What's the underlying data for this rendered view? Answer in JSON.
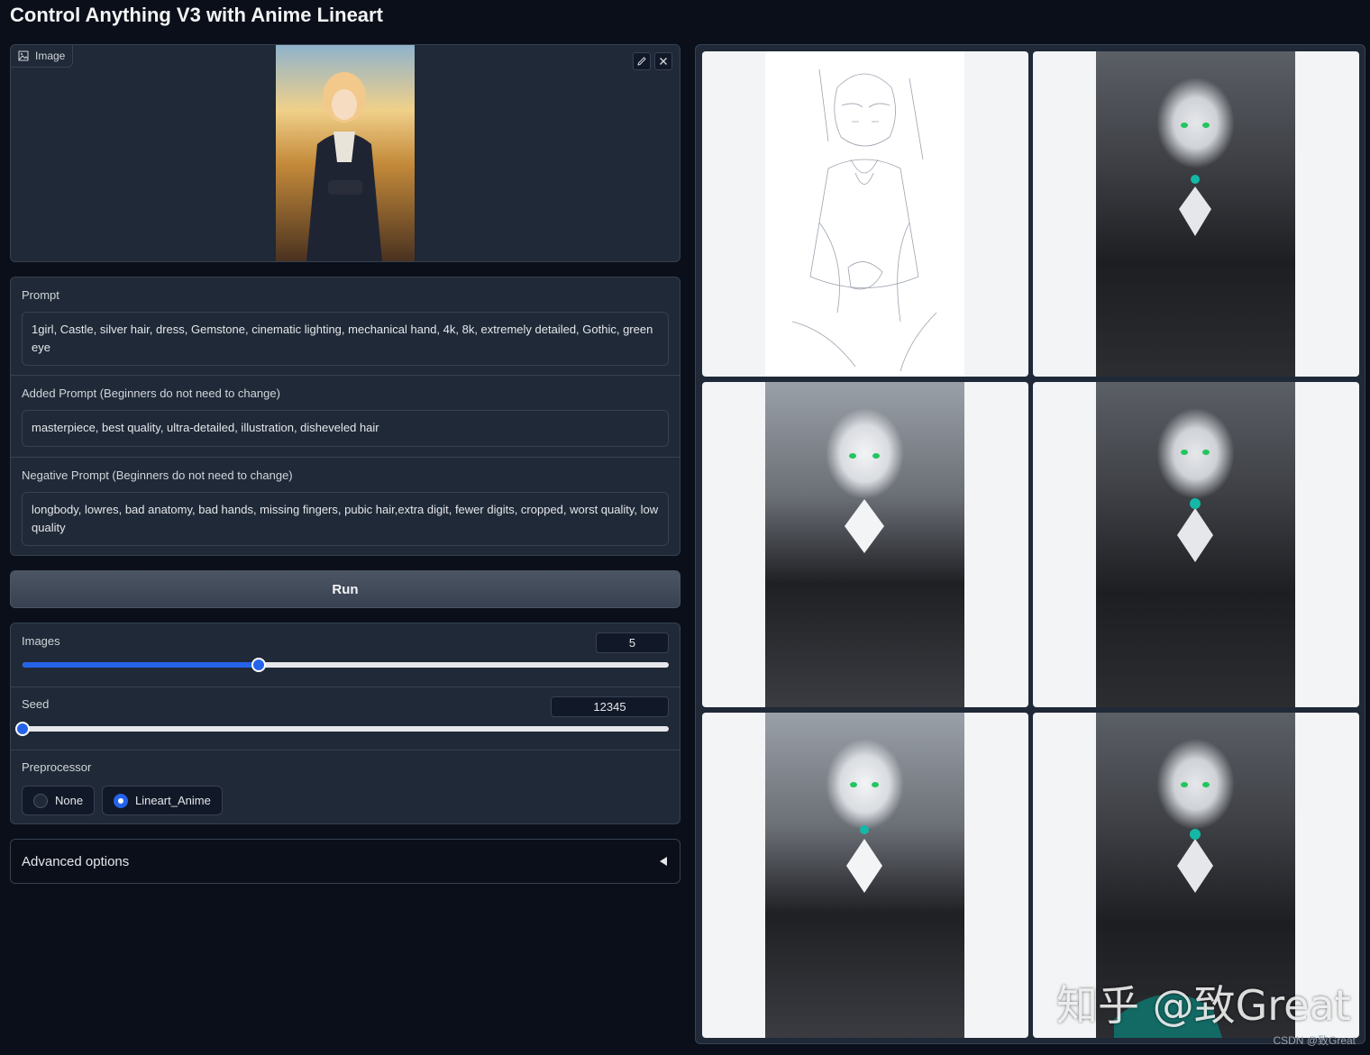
{
  "app": {
    "title": "Control Anything V3 with Anime Lineart"
  },
  "image_input": {
    "label": "Image"
  },
  "prompt": {
    "label": "Prompt",
    "value": "1girl, Castle, silver hair, dress, Gemstone, cinematic lighting, mechanical hand, 4k, 8k, extremely detailed, Gothic, green eye"
  },
  "added_prompt": {
    "label": "Added Prompt (Beginners do not need to change)",
    "value": "masterpiece, best quality, ultra-detailed, illustration, disheveled hair"
  },
  "negative_prompt": {
    "label": "Negative Prompt (Beginners do not need to change)",
    "value": "longbody, lowres, bad anatomy, bad hands, missing fingers, pubic hair,extra digit, fewer digits, cropped, worst quality, low quality"
  },
  "run_button": {
    "label": "Run"
  },
  "images_slider": {
    "label": "Images",
    "value": "5",
    "fraction": 0.365
  },
  "seed_slider": {
    "label": "Seed",
    "value": "12345",
    "fraction": 0.0
  },
  "preprocessor": {
    "label": "Preprocessor",
    "options": [
      "None",
      "Lineart_Anime"
    ],
    "selected": "Lineart_Anime"
  },
  "advanced": {
    "label": "Advanced options"
  },
  "gallery": {
    "count": 6
  },
  "watermark": {
    "text": "知乎 @致Great"
  },
  "credit": {
    "text": "CSDN @致Great"
  },
  "colors": {
    "accent": "#2563eb",
    "panel": "#1f2937",
    "background": "#0b0f19"
  }
}
